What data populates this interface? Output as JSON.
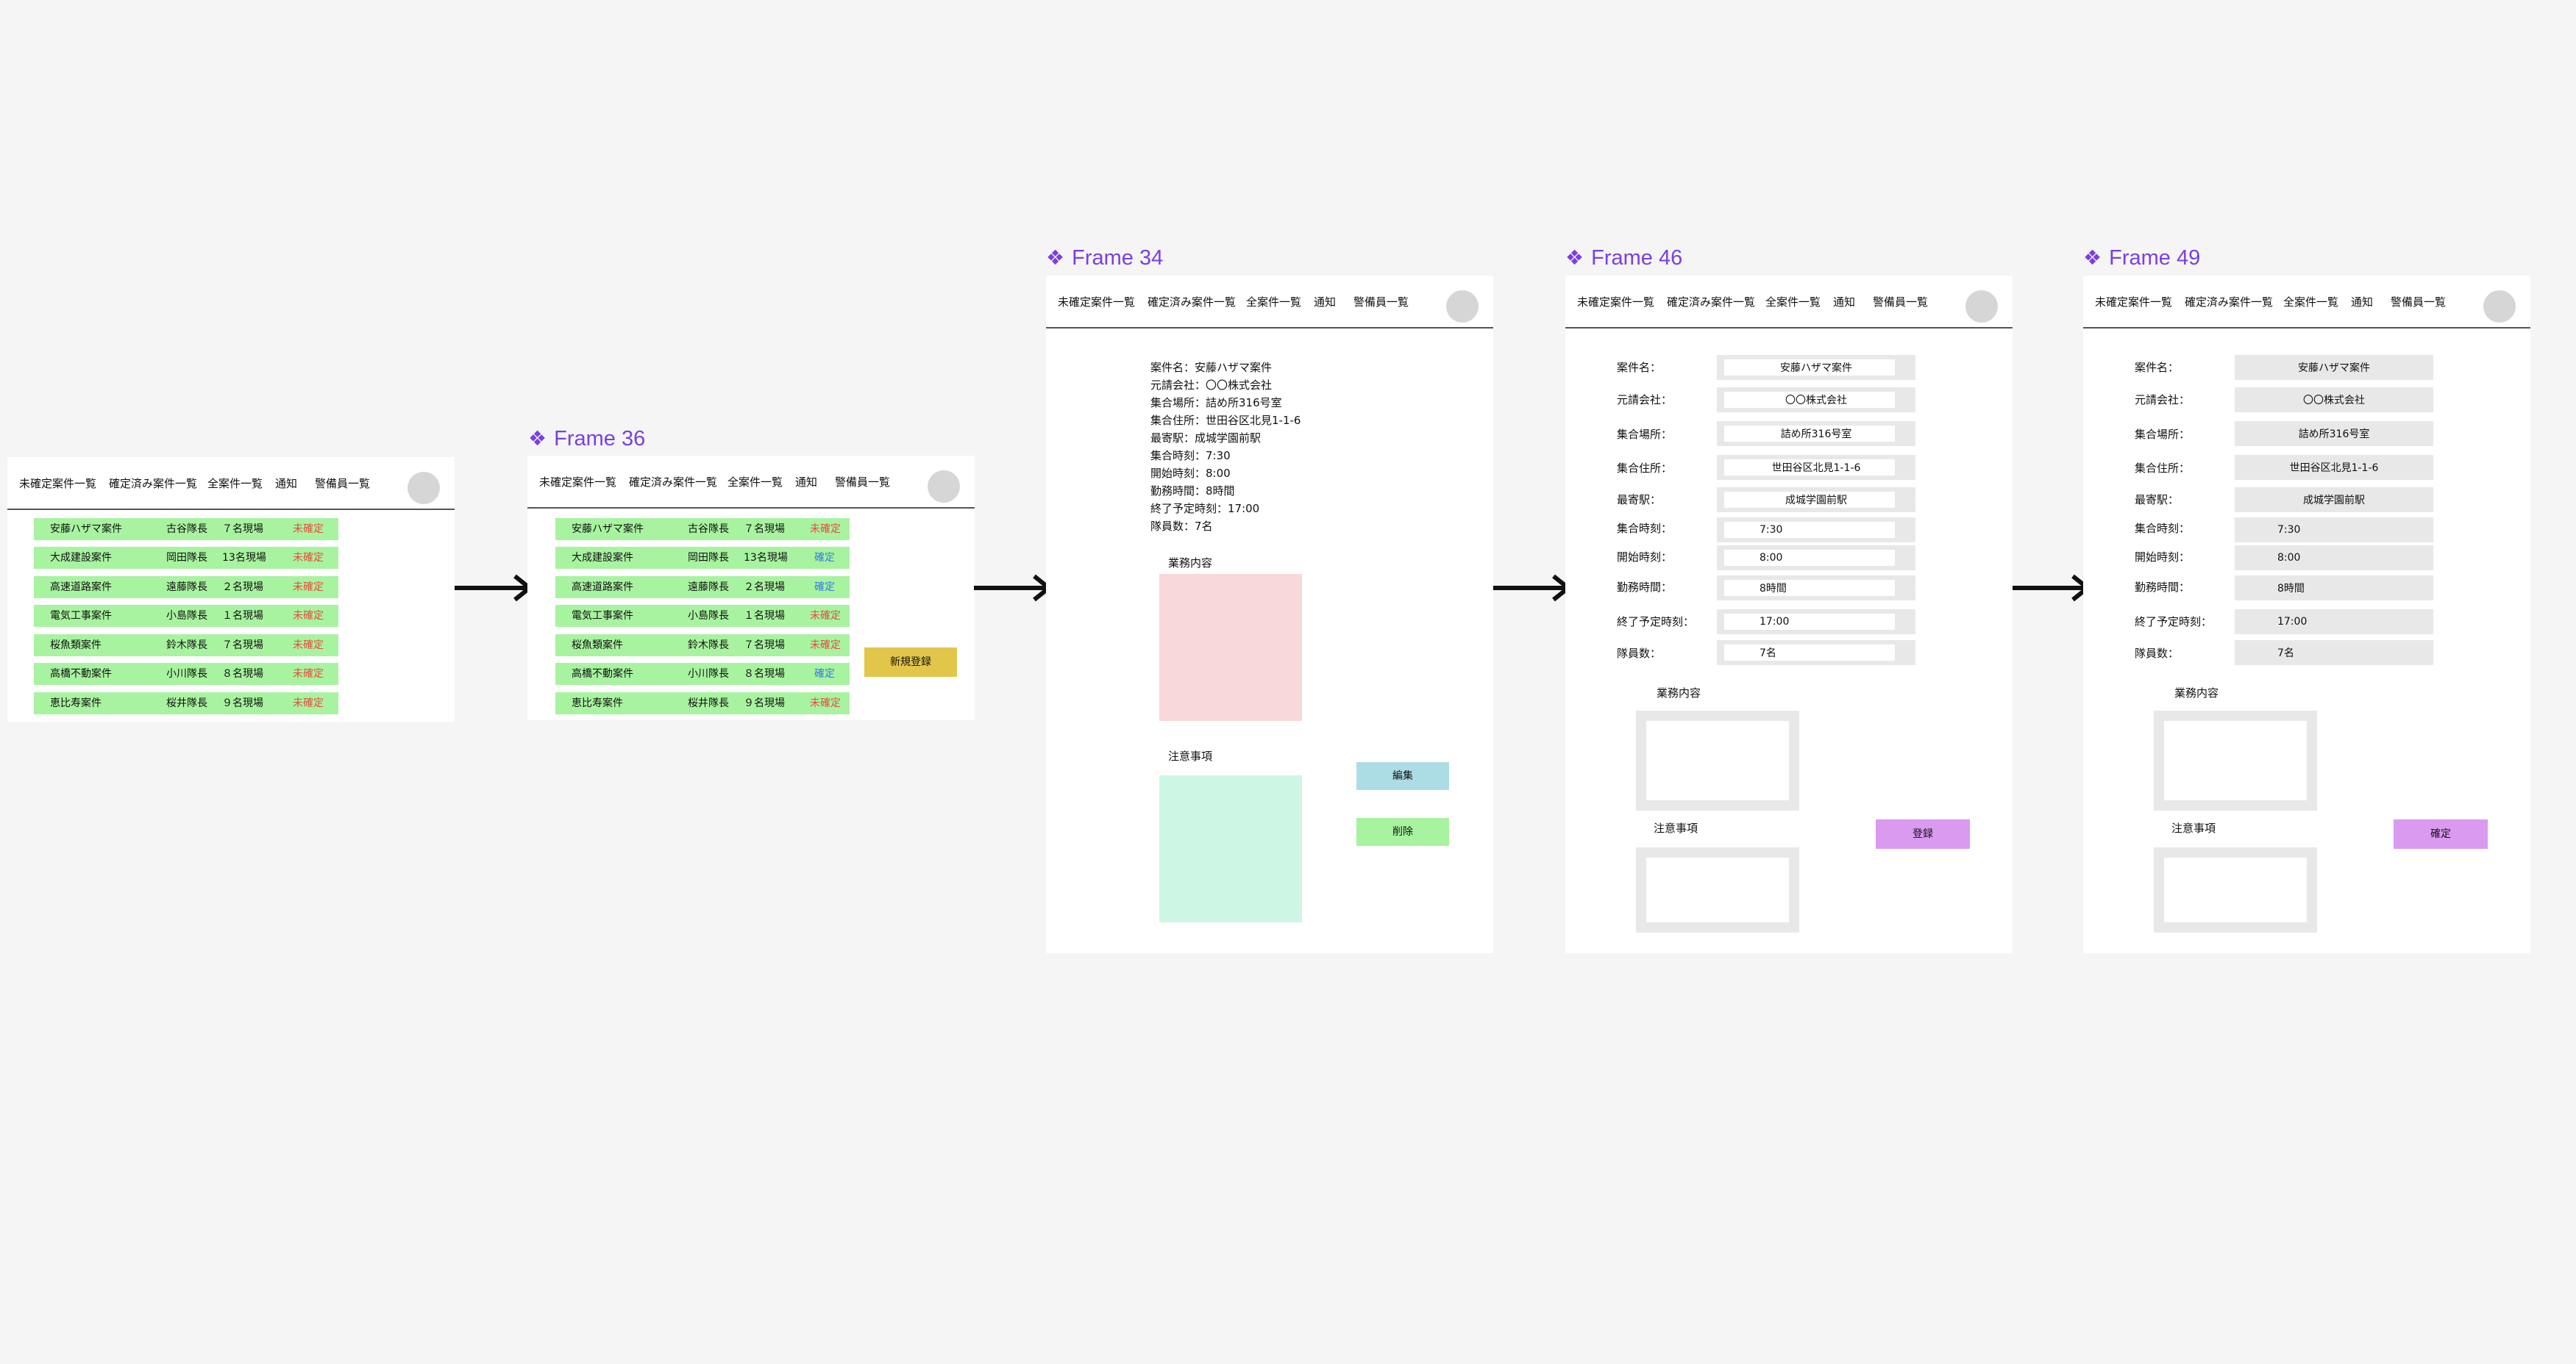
{
  "nav": {
    "unconfirmed": "未確定案件一覧",
    "confirmed": "確定済み案件一覧",
    "all": "全案件一覧",
    "notice": "通知",
    "guards": "警備員一覧"
  },
  "colors": {
    "frame_title": "#7b3fe0",
    "row_green": "#a8f3a0",
    "status_pending": "#e74c3c",
    "status_confirmed": "#3478f6",
    "new_btn": "#e2c64a",
    "edit_btn": "#acdde4",
    "delete_btn": "#a8f3a0",
    "register_btn": "#d99af0",
    "pink_area": "#f8d8d8",
    "mint_area": "#cdf7e4"
  },
  "frame1": {
    "rows": [
      {
        "name": "安藤ハザマ案件",
        "leader": "古谷隊長",
        "count": "７名現場",
        "status": "未確定"
      },
      {
        "name": "大成建設案件",
        "leader": "岡田隊長",
        "count": "13名現場",
        "status": "未確定"
      },
      {
        "name": "高速道路案件",
        "leader": "遠藤隊長",
        "count": "２名現場",
        "status": "未確定"
      },
      {
        "name": "電気工事案件",
        "leader": "小島隊長",
        "count": "１名現場",
        "status": "未確定"
      },
      {
        "name": "桜魚類案件",
        "leader": "鈴木隊長",
        "count": "７名現場",
        "status": "未確定"
      },
      {
        "name": "高橋不動案件",
        "leader": "小川隊長",
        "count": "８名現場",
        "status": "未確定"
      },
      {
        "name": "恵比寿案件",
        "leader": "桜井隊長",
        "count": "９名現場",
        "status": "未確定"
      }
    ]
  },
  "frame36": {
    "title": "Frame 36",
    "rows": [
      {
        "name": "安藤ハザマ案件",
        "leader": "古谷隊長",
        "count": "７名現場",
        "status": "未確定"
      },
      {
        "name": "大成建設案件",
        "leader": "岡田隊長",
        "count": "13名現場",
        "status": "確定"
      },
      {
        "name": "高速道路案件",
        "leader": "遠藤隊長",
        "count": "２名現場",
        "status": "確定"
      },
      {
        "name": "電気工事案件",
        "leader": "小島隊長",
        "count": "１名現場",
        "status": "未確定"
      },
      {
        "name": "桜魚類案件",
        "leader": "鈴木隊長",
        "count": "７名現場",
        "status": "未確定"
      },
      {
        "name": "高橋不動案件",
        "leader": "小川隊長",
        "count": "８名現場",
        "status": "確定"
      },
      {
        "name": "恵比寿案件",
        "leader": "桜井隊長",
        "count": "９名現場",
        "status": "未確定"
      }
    ],
    "new_button": "新規登録"
  },
  "frame34": {
    "title": "Frame 34",
    "details": [
      "案件名：安藤ハザマ案件",
      "元請会社：〇〇株式会社",
      "集合場所：詰め所316号室",
      "集合住所：世田谷区北見1-1-6",
      "最寄駅：成城学園前駅",
      "集合時刻：7:30",
      "開始時刻：8:00",
      "勤務時間：8時間",
      "終了予定時刻：17:00",
      "隊員数：7名"
    ],
    "work_label": "業務内容",
    "notes_label": "注意事項",
    "edit_button": "編集",
    "delete_button": "削除"
  },
  "frame46": {
    "title": "Frame 46",
    "fields": [
      {
        "label": "案件名：",
        "value": "安藤ハザマ案件"
      },
      {
        "label": "元請会社：",
        "value": "〇〇株式会社"
      },
      {
        "label": "集合場所：",
        "value": "詰め所316号室"
      },
      {
        "label": "集合住所：",
        "value": "世田谷区北見1-1-6"
      },
      {
        "label": "最寄駅：",
        "value": "成城学園前駅"
      },
      {
        "label": "集合時刻：",
        "value": "7:30"
      },
      {
        "label": "開始時刻：",
        "value": "8:00"
      },
      {
        "label": "勤務時間：",
        "value": "8時間"
      },
      {
        "label": "終了予定時刻：",
        "value": "17:00"
      },
      {
        "label": "隊員数：",
        "value": "7名"
      }
    ],
    "work_label": "業務内容",
    "notes_label": "注意事項",
    "register_button": "登録"
  },
  "frame49": {
    "title": "Frame 49",
    "fields": [
      {
        "label": "案件名：",
        "value": "安藤ハザマ案件"
      },
      {
        "label": "元請会社：",
        "value": "〇〇株式会社"
      },
      {
        "label": "集合場所：",
        "value": "詰め所316号室"
      },
      {
        "label": "集合住所：",
        "value": "世田谷区北見1-1-6"
      },
      {
        "label": "最寄駅：",
        "value": "成城学園前駅"
      },
      {
        "label": "集合時刻：",
        "value": "7:30"
      },
      {
        "label": "開始時刻：",
        "value": "8:00"
      },
      {
        "label": "勤務時間：",
        "value": "8時間"
      },
      {
        "label": "終了予定時刻：",
        "value": "17:00"
      },
      {
        "label": "隊員数：",
        "value": "7名"
      }
    ],
    "work_label": "業務内容",
    "notes_label": "注意事項",
    "confirm_button": "確定"
  }
}
